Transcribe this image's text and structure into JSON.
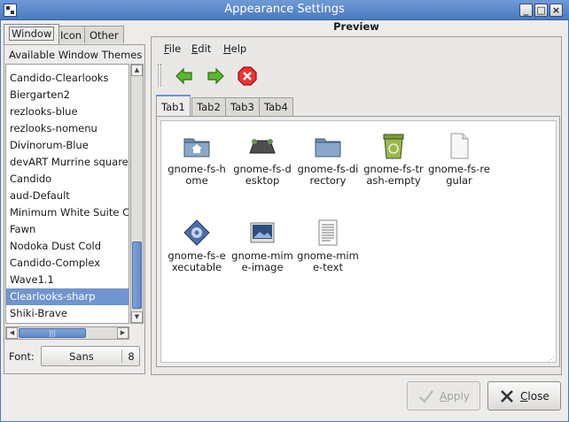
{
  "window": {
    "title": "Appearance Settings",
    "controls": [
      "_",
      "□",
      "×"
    ]
  },
  "left_tabs": [
    {
      "label": "Window",
      "active": true
    },
    {
      "label": "Icon",
      "active": false
    },
    {
      "label": "Other",
      "active": false
    }
  ],
  "themes": {
    "label": "Available Window Themes",
    "items": [
      "Candido-Clearlooks",
      "Biergarten2",
      "rezlooks-blue",
      "rezlooks-nomenu",
      "Divinorum-Blue",
      "devART Murrine square",
      "Candido",
      "aud-Default",
      "Minimum White Suite C",
      "Fawn",
      "Nodoka Dust Cold",
      "Candido-Complex",
      "Wave1.1",
      "Clearlooks-sharp",
      "Shiki-Brave"
    ],
    "selected": "Clearlooks-sharp"
  },
  "font": {
    "label": "Font:",
    "name": "Sans",
    "size": "8"
  },
  "preview": {
    "title": "Preview",
    "menus": [
      {
        "underline": "F",
        "rest": "ile"
      },
      {
        "underline": "E",
        "rest": "dit"
      },
      {
        "underline": "H",
        "rest": "elp"
      }
    ],
    "toolbar": [
      "go-back-icon",
      "go-forward-icon",
      "stop-icon"
    ],
    "tabs": [
      {
        "label": "Tab1",
        "active": true
      },
      {
        "label": "Tab2",
        "active": false
      },
      {
        "label": "Tab3",
        "active": false
      },
      {
        "label": "Tab4",
        "active": false
      }
    ],
    "icons": [
      {
        "icon": "folder-home-icon",
        "label": "gnome-fs-home"
      },
      {
        "icon": "desktop-icon",
        "label": "gnome-fs-desktop"
      },
      {
        "icon": "folder-icon",
        "label": "gnome-fs-directory"
      },
      {
        "icon": "trash-empty-icon",
        "label": "gnome-fs-trash-empty"
      },
      {
        "icon": "regular-file-icon",
        "label": "gnome-fs-regular"
      },
      {
        "icon": "executable-icon",
        "label": "gnome-fs-executable"
      },
      {
        "icon": "image-file-icon",
        "label": "gnome-mime-image"
      },
      {
        "icon": "text-file-icon",
        "label": "gnome-mime-text"
      }
    ]
  },
  "buttons": {
    "apply": {
      "underline": "A",
      "rest": "pply",
      "enabled": false
    },
    "close": {
      "underline": "C",
      "rest": "lose",
      "enabled": true
    }
  },
  "colors": {
    "titlebar": "#5a86c6",
    "selection": "#7095cf",
    "accent": "#6f93cf"
  }
}
